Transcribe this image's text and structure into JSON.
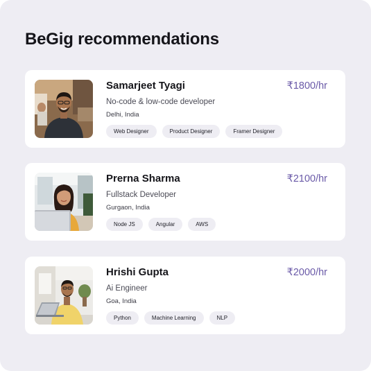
{
  "heading": "BeGig recommendations",
  "candidates": [
    {
      "name": "Samarjeet Tyagi",
      "role": "No-code & low-code developer",
      "location": "Delhi, India",
      "rate": "₹1800/hr",
      "tags": [
        "Web Designer",
        "Product Designer",
        "Framer Designer"
      ]
    },
    {
      "name": "Prerna Sharma",
      "role": "Fullstack Developer",
      "location": "Gurgaon, India",
      "rate": "₹2100/hr",
      "tags": [
        "Node JS",
        "Angular",
        "AWS"
      ]
    },
    {
      "name": "Hrishi Gupta",
      "role": "Ai Engineer",
      "location": "Goa, India",
      "rate": "₹2000/hr",
      "tags": [
        "Python",
        "Machine Learning",
        "NLP"
      ]
    }
  ],
  "colors": {
    "panel_bg": "#eeedf3",
    "card_bg": "#ffffff",
    "rate_accent": "#6a5aa8",
    "tag_bg": "#eeedf3"
  }
}
